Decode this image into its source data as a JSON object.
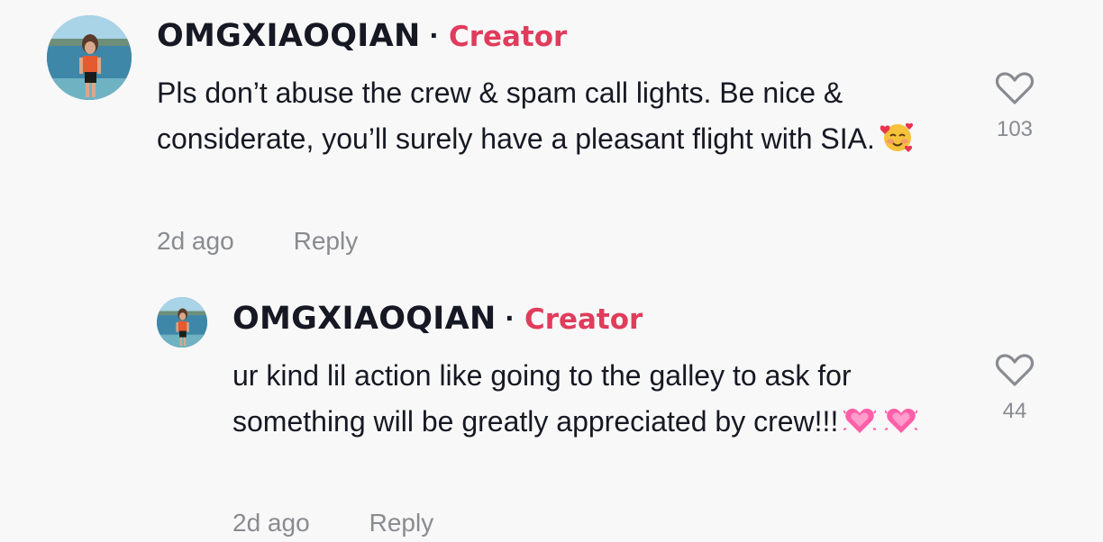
{
  "comments": [
    {
      "username": "OMGXIAOQIAN",
      "separator": "·",
      "badge": "Creator",
      "text": "Pls don’t abuse the crew & spam call lights. Be nice & considerate, you’ll surely have a pleasant flight with SIA.",
      "emoji": "smiling-face-with-hearts",
      "time": "2d ago",
      "reply_label": "Reply",
      "likes": "103"
    },
    {
      "username": "OMGXIAOQIAN",
      "separator": "·",
      "badge": "Creator",
      "text": "ur kind lil action like going to the galley to ask for something will be greatly appreciated by crew!!!",
      "emoji": "growing-heart",
      "time": "2d ago",
      "reply_label": "Reply",
      "likes": "44"
    }
  ],
  "colors": {
    "background": "#f8f8f8",
    "badge": "#e03c5c",
    "muted": "#8a8b91",
    "text": "#161823"
  }
}
